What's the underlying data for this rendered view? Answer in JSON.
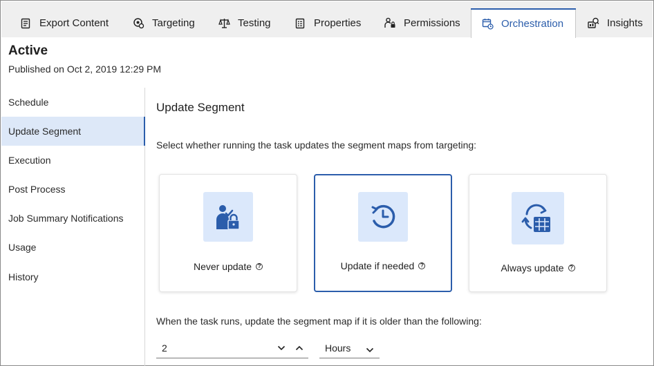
{
  "tabs": [
    {
      "label": "Export Content",
      "icon": "document-list-icon",
      "active": false
    },
    {
      "label": "Targeting",
      "icon": "target-gear-icon",
      "active": false
    },
    {
      "label": "Testing",
      "icon": "scale-icon",
      "active": false
    },
    {
      "label": "Properties",
      "icon": "properties-list-icon",
      "active": false
    },
    {
      "label": "Permissions",
      "icon": "user-lock-icon",
      "active": false
    },
    {
      "label": "Orchestration",
      "icon": "calendar-clock-icon",
      "active": true
    },
    {
      "label": "Insights",
      "icon": "insights-icon",
      "active": false
    }
  ],
  "header": {
    "status": "Active",
    "published": "Published on Oct 2, 2019 12:29 PM"
  },
  "sidebar": {
    "items": [
      {
        "label": "Schedule",
        "active": false
      },
      {
        "label": "Update Segment",
        "active": true
      },
      {
        "label": "Execution",
        "active": false
      },
      {
        "label": "Post Process",
        "active": false
      },
      {
        "label": "Job Summary Notifications",
        "active": false
      },
      {
        "label": "Usage",
        "active": false
      },
      {
        "label": "History",
        "active": false
      }
    ]
  },
  "main": {
    "title": "Update Segment",
    "instruction": "Select whether running the task updates the segment maps from targeting:",
    "options": [
      {
        "label": "Never update",
        "icon": "user-lock-icon",
        "selected": false
      },
      {
        "label": "Update if needed",
        "icon": "clock-refresh-icon",
        "selected": true
      },
      {
        "label": "Always update",
        "icon": "sync-table-icon",
        "selected": false
      }
    ],
    "help_glyph": "?",
    "runs_text": "When the task runs, update the segment map if it is older than the following:",
    "age_value": "2",
    "age_unit": "Hours"
  },
  "colors": {
    "accent": "#2b5dab",
    "selected_bg": "#dde8f8",
    "icon_bg": "#dbe8fb",
    "tabbar_bg": "#efefef"
  }
}
